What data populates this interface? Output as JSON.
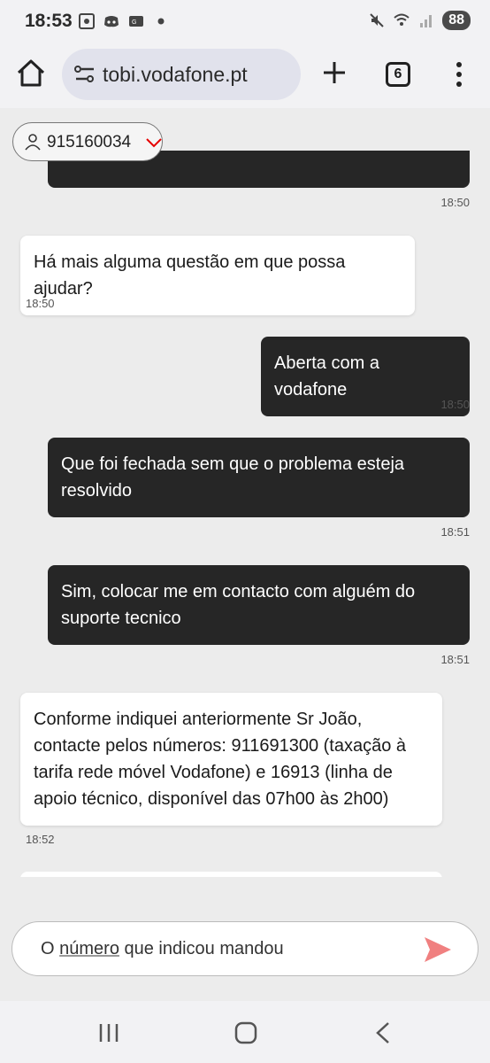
{
  "status_bar": {
    "time": "18:53",
    "battery": "88",
    "icons_left": [
      "screenshot-icon",
      "discord-icon",
      "gallery-icon",
      "dot-icon"
    ],
    "icons_right": [
      "mute-icon",
      "wifi-icon",
      "signal-icon",
      "battery-icon"
    ]
  },
  "browser": {
    "url": "tobi.vodafone.pt",
    "tab_count": "6"
  },
  "contact": {
    "number": "915160034"
  },
  "messages": [
    {
      "from": "user",
      "text": "",
      "time": "18:50"
    },
    {
      "from": "agent",
      "text": "Há mais alguma questão em que possa ajudar?",
      "time": "18:50"
    },
    {
      "from": "user",
      "text": "Aberta com a vodafone",
      "time": "18:50"
    },
    {
      "from": "user",
      "text": "Que foi fechada sem que o problema esteja resolvido",
      "time": "18:51"
    },
    {
      "from": "user",
      "text": "Sim, colocar me em contacto com alguém do suporte tecnico",
      "time": "18:51"
    },
    {
      "from": "agent",
      "text": "Conforme indiquei anteriormente Sr João, contacte pelos números: 911691300 (taxação à tarifa rede móvel Vodafone) e 16913 (linha de apoio técnico, disponível das 07h00 às 2h00)",
      "time": "18:52"
    }
  ],
  "composer": {
    "prefix": "O ",
    "underlined": "número",
    "suffix": " que indicou mandou"
  },
  "colors": {
    "accent": "#e60000",
    "send": "#f08080",
    "user_bubble": "#262626",
    "agent_bubble": "#ffffff"
  }
}
